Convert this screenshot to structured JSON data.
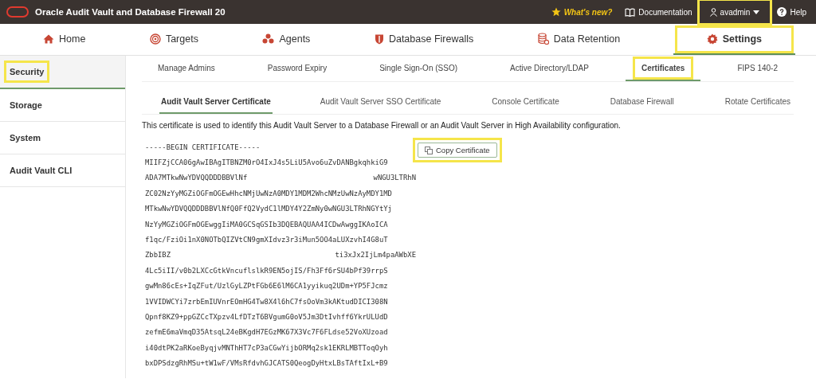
{
  "header": {
    "title": "Oracle Audit Vault and Database Firewall 20",
    "links": [
      {
        "kind": "whatsnew",
        "label": "What's new?"
      },
      {
        "kind": "docs",
        "label": "Documentation"
      },
      {
        "kind": "user",
        "label": "avadmin",
        "highlighted": true
      },
      {
        "kind": "help",
        "label": "Help"
      }
    ]
  },
  "nav": [
    {
      "kind": "home",
      "label": "Home",
      "selected": false,
      "highlighted": false
    },
    {
      "kind": "targets",
      "label": "Targets",
      "selected": false,
      "highlighted": false
    },
    {
      "kind": "agents",
      "label": "Agents",
      "selected": false,
      "highlighted": false
    },
    {
      "kind": "firewall",
      "label": "Database Firewalls",
      "selected": false,
      "highlighted": false
    },
    {
      "kind": "retention",
      "label": "Data Retention",
      "selected": false,
      "highlighted": false
    },
    {
      "kind": "settings",
      "label": "Settings",
      "selected": true,
      "highlighted": true
    }
  ],
  "sidebar": {
    "items": [
      {
        "label": "Security",
        "selected": true,
        "highlighted": true
      },
      {
        "label": "Storage",
        "selected": false,
        "highlighted": false
      },
      {
        "label": "System",
        "selected": false,
        "highlighted": false
      },
      {
        "label": "Audit Vault CLI",
        "selected": false,
        "highlighted": false
      }
    ]
  },
  "tabs": [
    {
      "label": "Manage Admins",
      "selected": false,
      "highlighted": false
    },
    {
      "label": "Password Expiry",
      "selected": false,
      "highlighted": false
    },
    {
      "label": "Single Sign-On (SSO)",
      "selected": false,
      "highlighted": false
    },
    {
      "label": "Active Directory/LDAP",
      "selected": false,
      "highlighted": false
    },
    {
      "label": "Certificates",
      "selected": true,
      "highlighted": true
    },
    {
      "label": "FIPS 140-2",
      "selected": false,
      "highlighted": false
    }
  ],
  "subtabs": [
    {
      "label": "Audit Vault Server Certificate",
      "selected": true
    },
    {
      "label": "Audit Vault Server SSO Certificate",
      "selected": false
    },
    {
      "label": "Console Certificate",
      "selected": false
    },
    {
      "label": "Database Firewall",
      "selected": false
    },
    {
      "label": "Rotate Certificates",
      "selected": false
    }
  ],
  "description": "This certificate is used to identify this Audit Vault Server to a Database Firewall or an Audit Vault Server in High Availability configuration.",
  "copy_button": {
    "label": "Copy Certificate",
    "highlighted": true
  },
  "certificate_lines": [
    [
      "-----BEGIN CERTIFICATE-----"
    ],
    [
      "MIIFZjCCA06gAwIBAgITBNZM0rO4IxJ4s5LiU5Avo6uZvDANBgkqhkiG9"
    ],
    [
      "ADA7MTkwNwYDVQQDDDBBVlNf",
      "wNGU3LTRhN"
    ],
    [
      "ZC02NzYyMGZiOGFmOGEwHhcNMjUwNzA0MDY1MDM2WhcNMzUwNzAyMDY1MD"
    ],
    [
      "MTkwNwYDVQQDDDBBVlNfQ0FfQ2VydC1lMDY4Y2ZmNy0wNGU3LTRhNGYtYj"
    ],
    [
      "NzYyMGZiOGFmOGEwggIiMA0GCSqGSIb3DQEBAQUAA4ICDwAwggIKAoICA"
    ],
    [
      "f1qc/FziOi1nX0NOTbQIZVtCN9gmXIdvz3r3iMun5OO4aLUXzvhI4G8uT"
    ],
    [
      "ZbbIBZ",
      "ti3xJx2IjLm4paAWbXE"
    ],
    [
      "4Lc5iII/v0b2LXCcGtkVncuflslkR9EN5ojIS/Fh3Ff6rSU4bPf39rrpS"
    ],
    [
      "gwMn86cEs+IqZFut/UzlGyLZPtFGb6E6lM6CA1yyikuq2UDm+YP5FJcmz"
    ],
    [
      "1VVIDWCYi7zrbEmIUVnrEOmHG4Tw8X4l6hC7fsOoVm3kAKtudDICI308N"
    ],
    [
      "Qpnf8KZ9+ppGZCcTXpzv4LfDTzT6BVgumG0oV5Jm3DtIvhff6YkrULUdD"
    ],
    [
      "zefmE6maVmqD35AtsqL24eBKgdH7EGzMK67X3Vc7F6FLdse52VoXUzoad"
    ],
    [
      "i40dtPK2aRKoeByqjvMNThHT7cP3aCGwYijbORMq2sk1EKRLMBTToqOyh"
    ],
    [
      "bxDPSdzgRhMSu+tW1wF/VMsRfdvhGJCATS0QeogDyHtxLBsTAftIxL+B9"
    ]
  ]
}
